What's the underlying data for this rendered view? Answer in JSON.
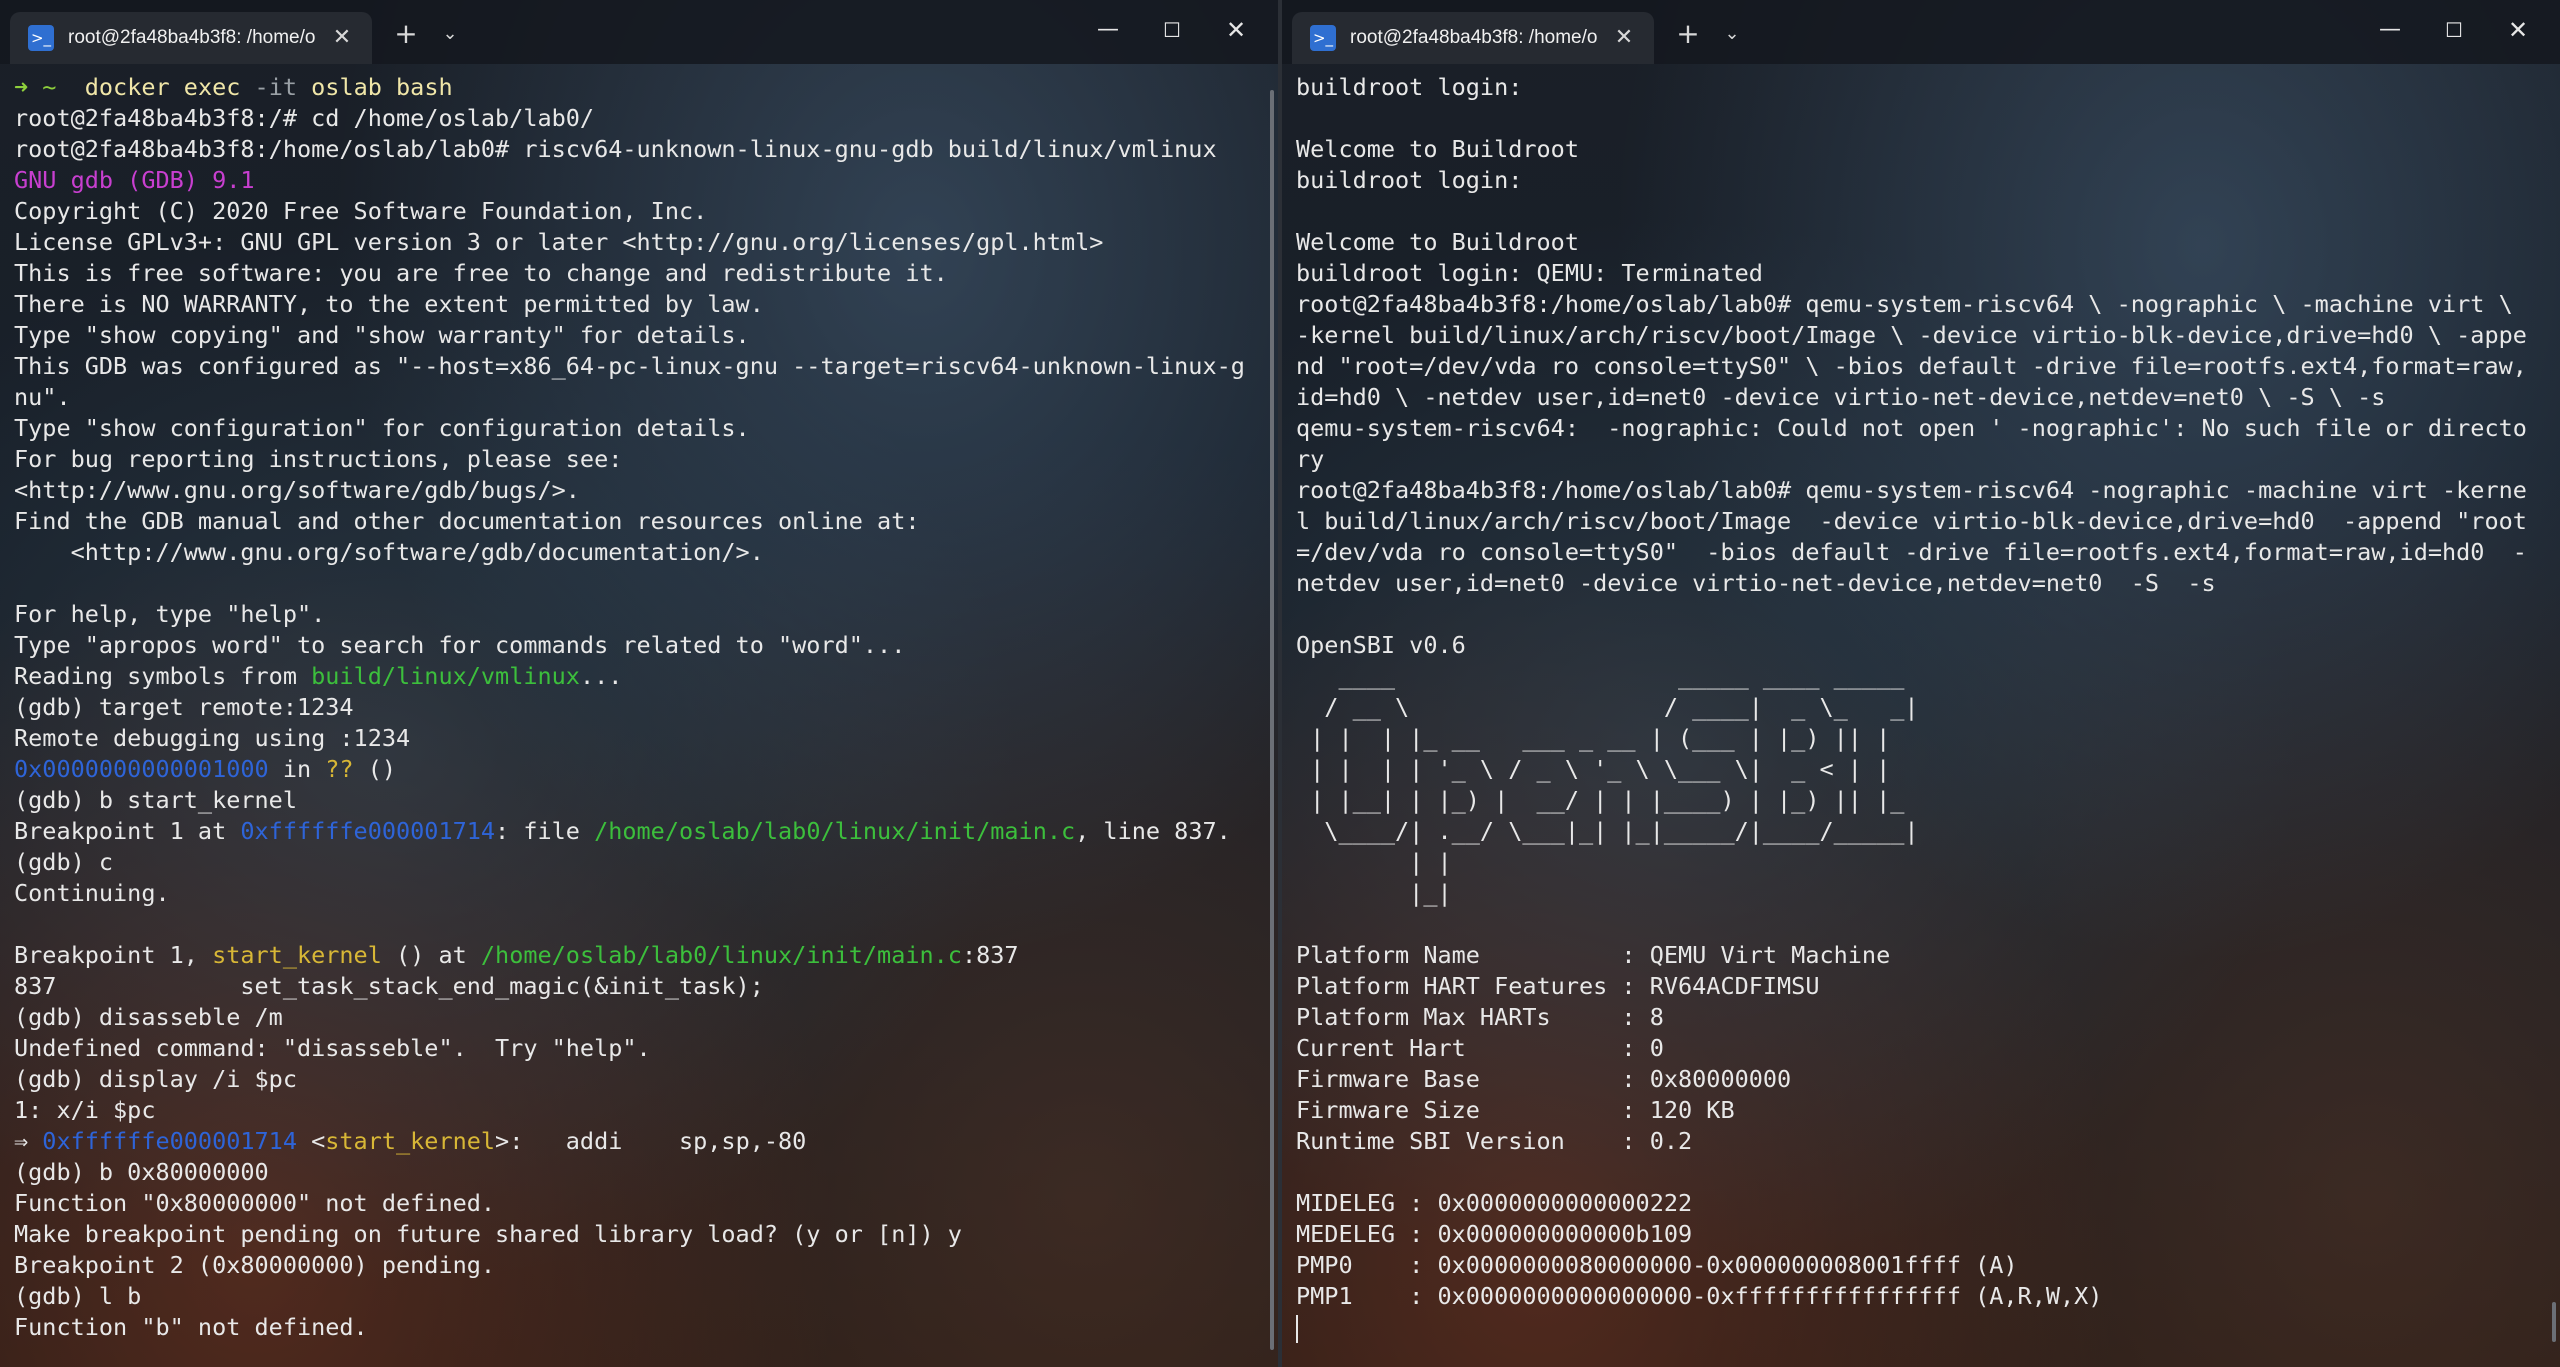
{
  "left": {
    "tab_title": "root@2fa48ba4b3f8: /home/o",
    "lines": [
      [
        {
          "t": "➜ ",
          "c": "c-prompt"
        },
        {
          "t": "~",
          "c": "c-prompt"
        },
        {
          "t": "  docker ",
          "c": "c-cmd"
        },
        {
          "t": "exec ",
          "c": "c-cmd"
        },
        {
          "t": "-it",
          "c": "c-dim"
        },
        {
          "t": " oslab bash",
          "c": "c-cmd"
        }
      ],
      [
        {
          "t": "root@2fa48ba4b3f8:/# cd /home/oslab/lab0/"
        }
      ],
      [
        {
          "t": "root@2fa48ba4b3f8:/home/oslab/lab0# riscv64-unknown-linux-gnu-gdb build/linux/vmlinux"
        }
      ],
      [
        {
          "t": "GNU gdb (GDB) 9.1",
          "c": "c-magenta"
        }
      ],
      [
        {
          "t": "Copyright (C) 2020 Free Software Foundation, Inc."
        }
      ],
      [
        {
          "t": "License GPLv3+: GNU GPL version 3 or later <http://gnu.org/licenses/gpl.html>"
        }
      ],
      [
        {
          "t": "This is free software: you are free to change and redistribute it."
        }
      ],
      [
        {
          "t": "There is NO WARRANTY, to the extent permitted by law."
        }
      ],
      [
        {
          "t": "Type \"show copying\" and \"show warranty\" for details."
        }
      ],
      [
        {
          "t": "This GDB was configured as \"--host=x86_64-pc-linux-gnu --target=riscv64-unknown-linux-g"
        }
      ],
      [
        {
          "t": "nu\"."
        }
      ],
      [
        {
          "t": "Type \"show configuration\" for configuration details."
        }
      ],
      [
        {
          "t": "For bug reporting instructions, please see:"
        }
      ],
      [
        {
          "t": "<http://www.gnu.org/software/gdb/bugs/>."
        }
      ],
      [
        {
          "t": "Find the GDB manual and other documentation resources online at:"
        }
      ],
      [
        {
          "t": "    <http://www.gnu.org/software/gdb/documentation/>."
        }
      ],
      [
        {
          "t": ""
        }
      ],
      [
        {
          "t": "For help, type \"help\"."
        }
      ],
      [
        {
          "t": "Type \"apropos word\" to search for commands related to \"word\"..."
        }
      ],
      [
        {
          "t": "Reading symbols from "
        },
        {
          "t": "build/linux/vmlinux",
          "c": "c-green"
        },
        {
          "t": "..."
        }
      ],
      [
        {
          "t": "(gdb) target remote:1234"
        }
      ],
      [
        {
          "t": "Remote debugging using :1234"
        }
      ],
      [
        {
          "t": "0x0000000000001000",
          "c": "c-blue"
        },
        {
          "t": " in "
        },
        {
          "t": "??",
          "c": "c-yellow"
        },
        {
          "t": " ()"
        }
      ],
      [
        {
          "t": "(gdb) b start_kernel"
        }
      ],
      [
        {
          "t": "Breakpoint 1 at "
        },
        {
          "t": "0xffffffe000001714",
          "c": "c-blue"
        },
        {
          "t": ": file "
        },
        {
          "t": "/home/oslab/lab0/linux/init/main.c",
          "c": "c-green"
        },
        {
          "t": ", line 837."
        }
      ],
      [
        {
          "t": "(gdb) c"
        }
      ],
      [
        {
          "t": "Continuing."
        }
      ],
      [
        {
          "t": ""
        }
      ],
      [
        {
          "t": "Breakpoint 1, "
        },
        {
          "t": "start_kernel",
          "c": "c-yellow"
        },
        {
          "t": " () at "
        },
        {
          "t": "/home/oslab/lab0/linux/init/main.c",
          "c": "c-green"
        },
        {
          "t": ":837"
        }
      ],
      [
        {
          "t": "837             set_task_stack_end_magic(&init_task);"
        }
      ],
      [
        {
          "t": "(gdb) disasseble /m"
        }
      ],
      [
        {
          "t": "Undefined command: \"disasseble\".  Try \"help\"."
        }
      ],
      [
        {
          "t": "(gdb) display /i $pc"
        }
      ],
      [
        {
          "t": "1: x/i $pc"
        }
      ],
      [
        {
          "t": "⇒ "
        },
        {
          "t": "0xffffffe000001714",
          "c": "c-blue"
        },
        {
          "t": " <"
        },
        {
          "t": "start_kernel",
          "c": "c-yellow"
        },
        {
          "t": ">:   addi    sp,sp,-80"
        }
      ],
      [
        {
          "t": "(gdb) b 0x80000000"
        }
      ],
      [
        {
          "t": "Function \"0x80000000\" not defined."
        }
      ],
      [
        {
          "t": "Make breakpoint pending on future shared library load? (y or [n]) y"
        }
      ],
      [
        {
          "t": "Breakpoint 2 (0x80000000) pending."
        }
      ],
      [
        {
          "t": "(gdb) l b"
        }
      ],
      [
        {
          "t": "Function \"b\" not defined."
        }
      ]
    ]
  },
  "right": {
    "tab_title": "root@2fa48ba4b3f8: /home/o",
    "lines": [
      [
        {
          "t": "buildroot login:"
        }
      ],
      [
        {
          "t": ""
        }
      ],
      [
        {
          "t": "Welcome to Buildroot"
        }
      ],
      [
        {
          "t": "buildroot login:"
        }
      ],
      [
        {
          "t": ""
        }
      ],
      [
        {
          "t": "Welcome to Buildroot"
        }
      ],
      [
        {
          "t": "buildroot login: QEMU: Terminated"
        }
      ],
      [
        {
          "t": "root@2fa48ba4b3f8:/home/oslab/lab0# qemu-system-riscv64 \\ -nographic \\ -machine virt \\"
        }
      ],
      [
        {
          "t": "-kernel build/linux/arch/riscv/boot/Image \\ -device virtio-blk-device,drive=hd0 \\ -appe"
        }
      ],
      [
        {
          "t": "nd \"root=/dev/vda ro console=ttyS0\" \\ -bios default -drive file=rootfs.ext4,format=raw,"
        }
      ],
      [
        {
          "t": "id=hd0 \\ -netdev user,id=net0 -device virtio-net-device,netdev=net0 \\ -S \\ -s"
        }
      ],
      [
        {
          "t": "qemu-system-riscv64:  -nographic: Could not open ' -nographic': No such file or directo"
        }
      ],
      [
        {
          "t": "ry"
        }
      ],
      [
        {
          "t": "root@2fa48ba4b3f8:/home/oslab/lab0# qemu-system-riscv64 -nographic -machine virt -kerne"
        }
      ],
      [
        {
          "t": "l build/linux/arch/riscv/boot/Image  -device virtio-blk-device,drive=hd0  -append \"root"
        }
      ],
      [
        {
          "t": "=/dev/vda ro console=ttyS0\"  -bios default -drive file=rootfs.ext4,format=raw,id=hd0  -"
        }
      ],
      [
        {
          "t": "netdev user,id=net0 -device virtio-net-device,netdev=net0  -S  -s"
        }
      ],
      [
        {
          "t": ""
        }
      ],
      [
        {
          "t": "OpenSBI v0.6"
        }
      ],
      [
        {
          "t": "   ____                    _____ ____ _____"
        }
      ],
      [
        {
          "t": "  / __ \\                  / ____|  _ \\_   _|"
        }
      ],
      [
        {
          "t": " | |  | |_ __   ___ _ __ | (___ | |_) || |"
        }
      ],
      [
        {
          "t": " | |  | | '_ \\ / _ \\ '_ \\ \\___ \\|  _ < | |"
        }
      ],
      [
        {
          "t": " | |__| | |_) |  __/ | | |____) | |_) || |_"
        }
      ],
      [
        {
          "t": "  \\____/| .__/ \\___|_| |_|_____/|____/_____|"
        }
      ],
      [
        {
          "t": "        | |"
        }
      ],
      [
        {
          "t": "        |_|"
        }
      ],
      [
        {
          "t": ""
        }
      ],
      [
        {
          "t": "Platform Name          : QEMU Virt Machine"
        }
      ],
      [
        {
          "t": "Platform HART Features : RV64ACDFIMSU"
        }
      ],
      [
        {
          "t": "Platform Max HARTs     : 8"
        }
      ],
      [
        {
          "t": "Current Hart           : 0"
        }
      ],
      [
        {
          "t": "Firmware Base          : 0x80000000"
        }
      ],
      [
        {
          "t": "Firmware Size          : 120 KB"
        }
      ],
      [
        {
          "t": "Runtime SBI Version    : 0.2"
        }
      ],
      [
        {
          "t": ""
        }
      ],
      [
        {
          "t": "MIDELEG : 0x0000000000000222"
        }
      ],
      [
        {
          "t": "MEDELEG : 0x000000000000b109"
        }
      ],
      [
        {
          "t": "PMP0    : 0x0000000080000000-0x000000008001ffff (A)"
        }
      ],
      [
        {
          "t": "PMP1    : 0x0000000000000000-0xffffffffffffffff (A,R,W,X)"
        }
      ]
    ]
  },
  "icons": {
    "tab": "terminal-prompt-icon",
    "close_tab": "✕",
    "new_tab": "+",
    "dropdown": "⌄",
    "minimize": "—",
    "maximize": "☐",
    "close": "✕"
  }
}
